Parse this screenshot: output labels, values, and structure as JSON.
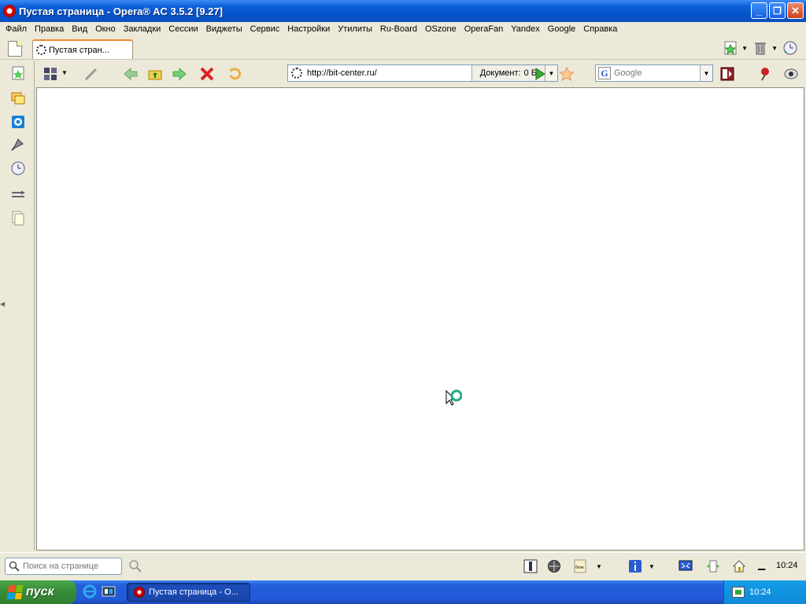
{
  "window": {
    "title": "Пустая страница - Opera® AC 3.5.2 [9.27]",
    "min_label": "_",
    "max_label": "❐",
    "close_label": "✕"
  },
  "menu": {
    "items": [
      "Файл",
      "Правка",
      "Вид",
      "Окно",
      "Закладки",
      "Сессии",
      "Виджеты",
      "Сервис",
      "Настройки",
      "Утилиты",
      "Ru-Board",
      "OSzone",
      "OperaFan",
      "Yandex",
      "Google",
      "Справка"
    ]
  },
  "tabs": [
    {
      "label": "Пустая стран..."
    }
  ],
  "address": {
    "url": "http://bit-center.ru/",
    "doc_label": "Документ:",
    "doc_size": "0 Б"
  },
  "search": {
    "engine_letter": "G",
    "placeholder": "Google"
  },
  "status": {
    "find_placeholder": "Поиск на странице",
    "clock": "10:24"
  },
  "taskbar": {
    "start_label": "пуск",
    "task_label": "Пустая страница - О...",
    "lang": "EN",
    "clock": "10:24"
  },
  "colors": {
    "titlebar": "#0653c8",
    "tab_accent": "#f08a30",
    "taskbar": "#245edb",
    "start_green": "#3a8f3a"
  }
}
